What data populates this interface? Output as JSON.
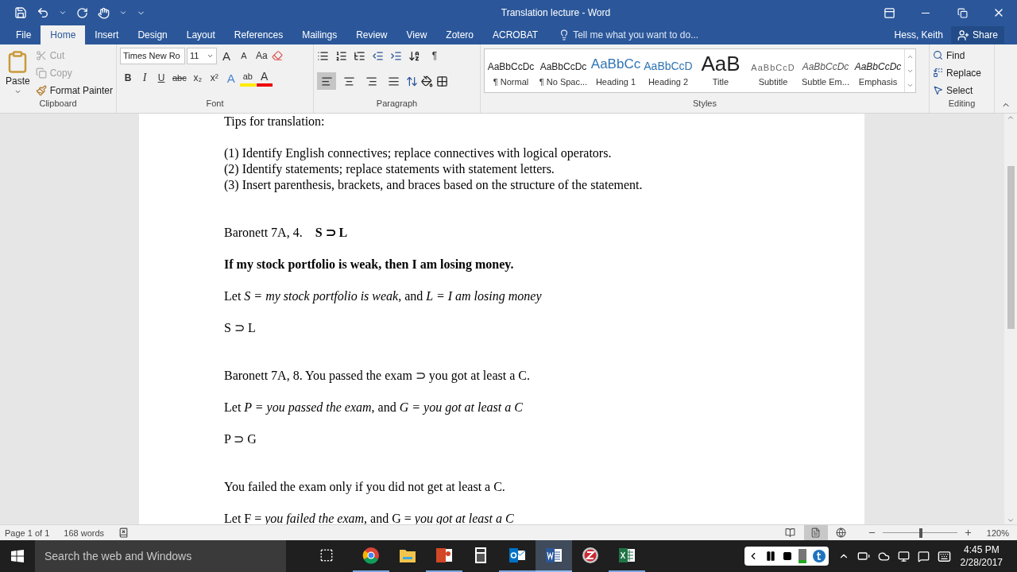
{
  "window": {
    "title": "Translation lecture - Word"
  },
  "tabs": [
    {
      "label": "File",
      "selected": false
    },
    {
      "label": "Home",
      "selected": true
    },
    {
      "label": "Insert",
      "selected": false
    },
    {
      "label": "Design",
      "selected": false
    },
    {
      "label": "Layout",
      "selected": false
    },
    {
      "label": "References",
      "selected": false
    },
    {
      "label": "Mailings",
      "selected": false
    },
    {
      "label": "Review",
      "selected": false
    },
    {
      "label": "View",
      "selected": false
    },
    {
      "label": "Zotero",
      "selected": false
    },
    {
      "label": "ACROBAT",
      "selected": false
    }
  ],
  "tell_me": {
    "placeholder": "Tell me what you want to do..."
  },
  "user": "Hess, Keith",
  "share": "Share",
  "clipboard": {
    "label": "Clipboard",
    "paste": "Paste",
    "items": [
      {
        "label": "Cut",
        "kind": "cut",
        "disabled": true
      },
      {
        "label": "Copy",
        "kind": "copy",
        "disabled": true
      },
      {
        "label": "Format Painter",
        "kind": "painter",
        "disabled": false
      }
    ]
  },
  "font": {
    "label": "Font",
    "name": "Times New Ro",
    "size": "11",
    "top_tools": [
      {
        "kind": "grow",
        "glyph": "A"
      },
      {
        "kind": "shrink",
        "glyph": "A"
      },
      {
        "kind": "case",
        "glyph": "Aa"
      }
    ],
    "format_tools": [
      {
        "kind": "bold",
        "glyph": "B"
      },
      {
        "kind": "italic",
        "glyph": "I"
      },
      {
        "kind": "underline",
        "glyph": "U"
      },
      {
        "kind": "strike",
        "glyph": "abc"
      },
      {
        "kind": "sub",
        "glyph": "x₂"
      },
      {
        "kind": "sup",
        "glyph": "x²"
      },
      {
        "kind": "effects",
        "glyph": "A"
      },
      {
        "kind": "highlight",
        "glyph": "ab"
      },
      {
        "kind": "color",
        "glyph": "A"
      }
    ]
  },
  "paragraph": {
    "label": "Paragraph",
    "show_marks": "¶",
    "alignment": [
      {
        "kind": "left",
        "selected": true
      },
      {
        "kind": "center",
        "selected": false
      },
      {
        "kind": "right",
        "selected": false
      },
      {
        "kind": "justify",
        "selected": false
      }
    ]
  },
  "styles": {
    "label": "Styles",
    "items": [
      {
        "preview": "AaBbCcDc",
        "label": "¶ Normal",
        "kind": "normal"
      },
      {
        "preview": "AaBbCcDc",
        "label": "¶ No Spac...",
        "kind": "normal"
      },
      {
        "preview": "AaBbCc",
        "label": "Heading 1",
        "kind": "heading1"
      },
      {
        "preview": "AaBbCcD",
        "label": "Heading 2",
        "kind": "heading2"
      },
      {
        "preview": "AaB",
        "label": "Title",
        "kind": "title"
      },
      {
        "preview": "AaBbCcD",
        "label": "Subtitle",
        "kind": "subtitle"
      },
      {
        "preview": "AaBbCcDc",
        "label": "Subtle Em...",
        "kind": "subtle"
      },
      {
        "preview": "AaBbCcDc",
        "label": "Emphasis",
        "kind": "emphasis"
      }
    ]
  },
  "editing": {
    "label": "Editing",
    "items": [
      {
        "label": "Find",
        "kind": "find"
      },
      {
        "label": "Replace",
        "kind": "replace"
      },
      {
        "label": "Select",
        "kind": "select"
      }
    ]
  },
  "document": [
    {
      "kind": "first",
      "lines": [
        {
          "text": "Tips for translation:"
        }
      ]
    },
    {
      "kind": "paragraph",
      "lines": [
        {
          "text": "(1) Identify English connectives; replace connectives with logical operators."
        },
        {
          "text": "(2) Identify statements; replace statements with statement letters."
        },
        {
          "text": "(3) Insert parenthesis, brackets, and braces based on the structure of the statement."
        }
      ]
    },
    {
      "kind": "section",
      "lines": [
        {
          "text": "Baronett 7A, 4.    **S ⊃ L**"
        }
      ]
    },
    {
      "kind": "paragraph",
      "lines": [
        {
          "text": "If my stock portfolio is weak, then I am losing money.",
          "bold": true
        }
      ]
    },
    {
      "kind": "paragraph",
      "lines": [
        {
          "text": "Let *S = my stock portfolio is weak*, and *L = I am losing money*"
        }
      ]
    },
    {
      "kind": "paragraph",
      "lines": [
        {
          "text": "S ⊃ L"
        }
      ]
    },
    {
      "kind": "section",
      "lines": [
        {
          "text": "Baronett 7A, 8. You passed the exam ⊃ you got at least a C."
        }
      ]
    },
    {
      "kind": "paragraph",
      "lines": [
        {
          "text": "Let *P = you passed the exam*, and *G = you got at least a C*"
        }
      ]
    },
    {
      "kind": "paragraph",
      "lines": [
        {
          "text": "P ⊃ G"
        }
      ]
    },
    {
      "kind": "section",
      "lines": [
        {
          "text": "You failed the exam only if you did not get at least a C."
        }
      ]
    },
    {
      "kind": "paragraph",
      "lines": [
        {
          "text": "Let F = *you failed the exam*, and G = *you got at least a C*"
        }
      ]
    }
  ],
  "status_bar": {
    "page": "Page 1 of 1",
    "words": "168 words",
    "views": [
      {
        "kind": "read",
        "selected": false
      },
      {
        "kind": "print",
        "selected": true
      },
      {
        "kind": "web",
        "selected": false
      }
    ],
    "zoom": {
      "level": 0.51,
      "reading": "120%"
    }
  },
  "taskbar": {
    "search": {
      "placeholder": "Search the web and Windows"
    },
    "apps": [
      {
        "kind": "chrome",
        "running": true,
        "active": false
      },
      {
        "kind": "explorer",
        "running": false,
        "active": false
      },
      {
        "kind": "powerpoint",
        "running": true,
        "active": false
      },
      {
        "kind": "calculator",
        "running": false,
        "active": false
      },
      {
        "kind": "outlook",
        "running": true,
        "active": false
      },
      {
        "kind": "word",
        "running": true,
        "active": true
      },
      {
        "kind": "zotero",
        "running": false,
        "active": false
      },
      {
        "kind": "excel",
        "running": true,
        "active": false
      }
    ],
    "time": "4:45 PM",
    "date": "2/28/2017"
  }
}
